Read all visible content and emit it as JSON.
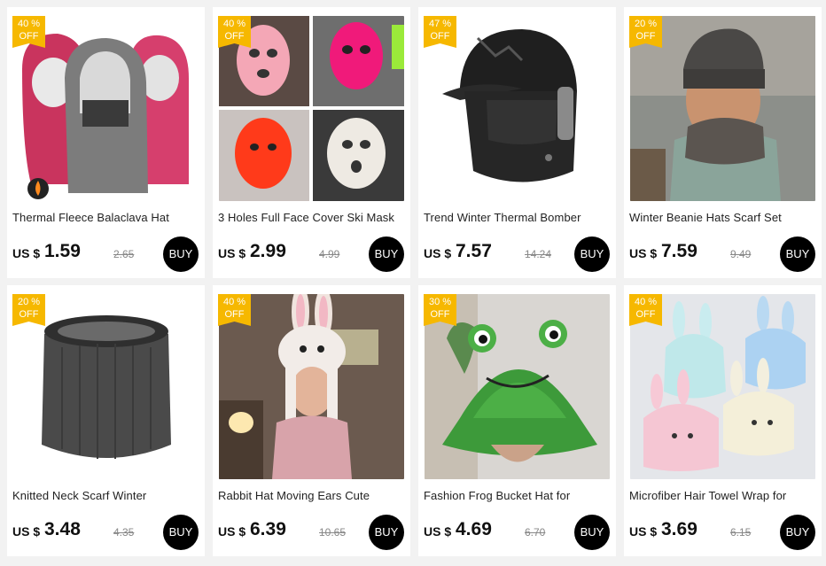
{
  "currency_label": "US $",
  "buy_label": "BUY",
  "colors": {
    "badge": "#f6b800",
    "buy_button": "#000000",
    "page_bg": "#f2f2f2"
  },
  "products": [
    {
      "title": "Thermal Fleece Balaclava Hat",
      "discount_pct": "40",
      "discount_unit": "%",
      "discount_word": "OFF",
      "price": "1.59",
      "old_price": "2.65",
      "image": "balaclava-hoods"
    },
    {
      "title": "3 Holes Full Face Cover Ski Mask",
      "discount_pct": "40",
      "discount_unit": "%",
      "discount_word": "OFF",
      "price": "2.99",
      "old_price": "4.99",
      "image": "ski-masks-collage"
    },
    {
      "title": "Trend Winter Thermal Bomber",
      "discount_pct": "47",
      "discount_unit": "%",
      "discount_word": "OFF",
      "price": "7.57",
      "old_price": "14.24",
      "image": "bomber-cap"
    },
    {
      "title": "Winter Beanie Hats Scarf Set",
      "discount_pct": "20",
      "discount_unit": "%",
      "discount_word": "OFF",
      "price": "7.59",
      "old_price": "9.49",
      "image": "beanie-man"
    },
    {
      "title": "Knitted Neck Scarf Winter",
      "discount_pct": "20",
      "discount_unit": "%",
      "discount_word": "OFF",
      "price": "3.48",
      "old_price": "4.35",
      "image": "neck-scarf"
    },
    {
      "title": "Rabbit Hat Moving Ears Cute",
      "discount_pct": "40",
      "discount_unit": "%",
      "discount_word": "OFF",
      "price": "6.39",
      "old_price": "10.65",
      "image": "rabbit-hat"
    },
    {
      "title": "Fashion Frog Bucket Hat for",
      "discount_pct": "30",
      "discount_unit": "%",
      "discount_word": "OFF",
      "price": "4.69",
      "old_price": "6.70",
      "image": "frog-hat"
    },
    {
      "title": "Microfiber Hair Towel Wrap for",
      "discount_pct": "40",
      "discount_unit": "%",
      "discount_word": "OFF",
      "price": "3.69",
      "old_price": "6.15",
      "image": "towel-wraps"
    }
  ]
}
